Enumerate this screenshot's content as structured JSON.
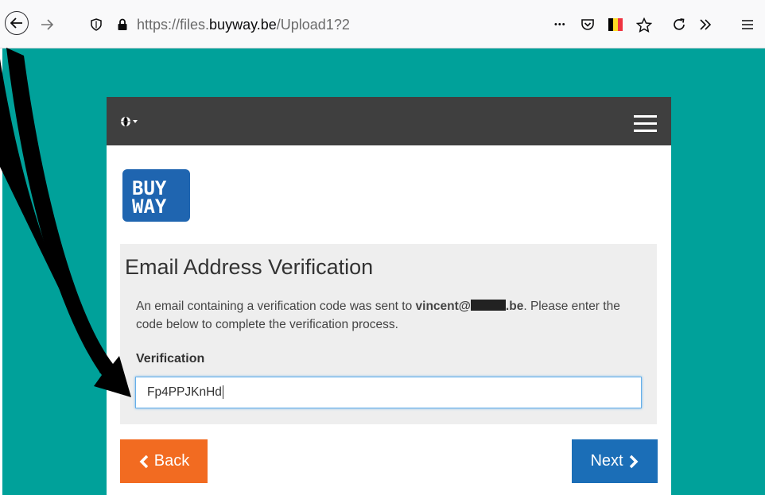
{
  "browser": {
    "url_prefix": "https://files.",
    "url_domain": "buyway.be",
    "url_path": "/Upload1?2",
    "more_label": "•••"
  },
  "logo": {
    "line1": "BUY",
    "line2": "WAY"
  },
  "page": {
    "title": "Email Address Verification",
    "message_before": "An email containing a verification code was sent to ",
    "email_user": "vincent@",
    "email_domain_end": ".be",
    "message_after": ". Please enter the code below to complete the verification process.",
    "field_label": "Verification",
    "field_value": "Fp4PPJKnHd"
  },
  "buttons": {
    "back": "Back",
    "next": "Next"
  },
  "colors": {
    "teal_background": "#00a19a",
    "nav_dark": "#3f3f3f",
    "back_orange": "#f26b21",
    "next_blue": "#1b6eb7",
    "logo_blue": "#1f65b0"
  }
}
